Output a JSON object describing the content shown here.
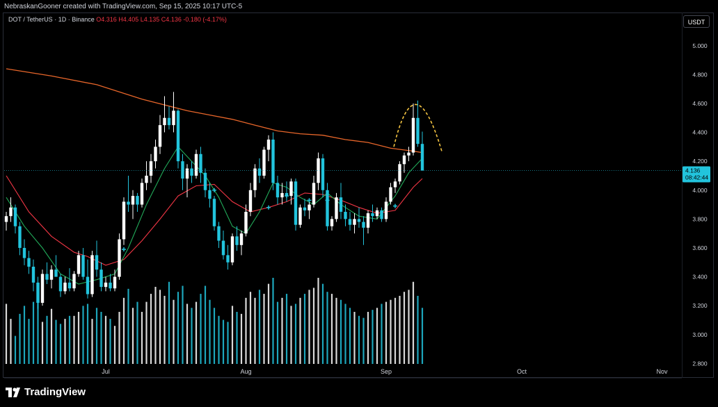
{
  "header": {
    "credit": "NebraskanGooner created with TradingView.com, Sep 15, 2025 10:17 UTC-5"
  },
  "legend": {
    "symbol": "DOT / TetherUS · 1D · Binance",
    "ohlc": "O4.316  H4.405  L4.135  C4.136  -0.180 (-4.17%)"
  },
  "price_axis": {
    "unit": "USDT"
  },
  "last_price": {
    "value": "4.136",
    "countdown": "08:42:44"
  },
  "footer": {
    "brand": "TradingView"
  },
  "colors": {
    "up": "#ffffff",
    "down": "#22c4dd",
    "ma_long": "#e8662a",
    "ma_mid": "#f23645",
    "ma_short": "#22ab5a",
    "annotation": "#f5c542",
    "badge": "#22c4dd"
  },
  "chart_data": {
    "type": "candlestick",
    "interval": "1D",
    "ylim": [
      2.72,
      5.22
    ],
    "y_ticks": [
      2.8,
      3.0,
      3.2,
      3.4,
      3.6,
      3.8,
      4.0,
      4.2,
      4.4,
      4.6,
      4.8,
      5.0
    ],
    "x_ticks": [
      "Jul",
      "Aug",
      "Sep",
      "Oct",
      "Nov"
    ],
    "x_range_days": [
      "2025-06-09",
      "2025-11-18"
    ],
    "ohlc_daily_from": "2025-06-09",
    "candles": [
      [
        3.78,
        3.85,
        3.72,
        3.82
      ],
      [
        3.82,
        3.95,
        3.78,
        3.88
      ],
      [
        3.88,
        3.9,
        3.7,
        3.75
      ],
      [
        3.75,
        3.78,
        3.55,
        3.6
      ],
      [
        3.6,
        3.66,
        3.48,
        3.53
      ],
      [
        3.53,
        3.58,
        3.42,
        3.47
      ],
      [
        3.47,
        3.52,
        3.3,
        3.36
      ],
      [
        3.36,
        3.4,
        3.18,
        3.22
      ],
      [
        3.22,
        3.45,
        3.2,
        3.42
      ],
      [
        3.42,
        3.5,
        3.35,
        3.38
      ],
      [
        3.38,
        3.48,
        3.32,
        3.45
      ],
      [
        3.45,
        3.55,
        3.4,
        3.4
      ],
      [
        3.4,
        3.42,
        3.26,
        3.3
      ],
      [
        3.3,
        3.4,
        3.28,
        3.36
      ],
      [
        3.36,
        3.46,
        3.3,
        3.32
      ],
      [
        3.32,
        3.44,
        3.3,
        3.42
      ],
      [
        3.42,
        3.58,
        3.4,
        3.55
      ],
      [
        3.55,
        3.6,
        3.38,
        3.4
      ],
      [
        3.4,
        3.52,
        3.25,
        3.28
      ],
      [
        3.28,
        3.58,
        3.26,
        3.55
      ],
      [
        3.55,
        3.65,
        3.4,
        3.45
      ],
      [
        3.45,
        3.5,
        3.3,
        3.33
      ],
      [
        3.33,
        3.4,
        3.3,
        3.36
      ],
      [
        3.36,
        3.42,
        3.3,
        3.32
      ],
      [
        3.32,
        3.45,
        3.3,
        3.4
      ],
      [
        3.4,
        3.7,
        3.38,
        3.66
      ],
      [
        3.66,
        3.95,
        3.62,
        3.92
      ],
      [
        3.92,
        4.1,
        3.85,
        3.9
      ],
      [
        3.9,
        4.0,
        3.8,
        3.96
      ],
      [
        3.96,
        3.98,
        3.85,
        3.9
      ],
      [
        3.9,
        4.08,
        3.88,
        4.05
      ],
      [
        4.05,
        4.2,
        4.0,
        4.1
      ],
      [
        4.1,
        4.25,
        4.05,
        4.2
      ],
      [
        4.2,
        4.35,
        4.15,
        4.3
      ],
      [
        4.3,
        4.52,
        4.25,
        4.45
      ],
      [
        4.45,
        4.65,
        4.4,
        4.5
      ],
      [
        4.5,
        4.58,
        4.42,
        4.45
      ],
      [
        4.45,
        4.68,
        4.4,
        4.55
      ],
      [
        4.55,
        4.56,
        4.15,
        4.2
      ],
      [
        4.2,
        4.25,
        4.0,
        4.08
      ],
      [
        4.08,
        4.18,
        3.95,
        4.15
      ],
      [
        4.15,
        4.2,
        4.05,
        4.1
      ],
      [
        4.1,
        4.28,
        4.08,
        4.25
      ],
      [
        4.25,
        4.3,
        4.05,
        4.12
      ],
      [
        4.12,
        4.15,
        3.95,
        4.0
      ],
      [
        4.0,
        4.05,
        3.88,
        3.94
      ],
      [
        3.94,
        3.96,
        3.72,
        3.75
      ],
      [
        3.75,
        3.78,
        3.6,
        3.65
      ],
      [
        3.65,
        3.72,
        3.52,
        3.55
      ],
      [
        3.55,
        3.62,
        3.45,
        3.5
      ],
      [
        3.5,
        3.7,
        3.48,
        3.68
      ],
      [
        3.68,
        3.75,
        3.58,
        3.62
      ],
      [
        3.62,
        3.72,
        3.55,
        3.7
      ],
      [
        3.7,
        3.9,
        3.68,
        3.85
      ],
      [
        3.85,
        4.05,
        3.82,
        4.0
      ],
      [
        4.0,
        4.18,
        3.95,
        4.15
      ],
      [
        4.15,
        4.22,
        4.05,
        4.1
      ],
      [
        4.1,
        4.3,
        4.08,
        4.28
      ],
      [
        4.28,
        4.38,
        4.2,
        4.35
      ],
      [
        4.35,
        4.4,
        4.0,
        4.05
      ],
      [
        4.05,
        4.1,
        3.9,
        3.95
      ],
      [
        3.95,
        4.05,
        3.9,
        3.98
      ],
      [
        3.98,
        4.06,
        3.92,
        3.96
      ],
      [
        3.96,
        4.08,
        3.9,
        4.06
      ],
      [
        4.06,
        4.08,
        3.72,
        3.76
      ],
      [
        3.76,
        3.9,
        3.74,
        3.88
      ],
      [
        3.88,
        3.94,
        3.82,
        3.86
      ],
      [
        3.86,
        3.92,
        3.8,
        3.9
      ],
      [
        3.9,
        4.1,
        3.88,
        4.05
      ],
      [
        4.05,
        4.26,
        4.0,
        4.22
      ],
      [
        4.22,
        4.25,
        3.95,
        4.0
      ],
      [
        4.0,
        4.05,
        3.72,
        3.75
      ],
      [
        3.75,
        3.82,
        3.72,
        3.8
      ],
      [
        3.8,
        3.98,
        3.78,
        3.95
      ],
      [
        3.95,
        4.05,
        3.8,
        3.85
      ],
      [
        3.85,
        3.9,
        3.75,
        3.8
      ],
      [
        3.8,
        3.85,
        3.72,
        3.76
      ],
      [
        3.76,
        3.84,
        3.7,
        3.8
      ],
      [
        3.8,
        3.88,
        3.74,
        3.78
      ],
      [
        3.78,
        3.82,
        3.62,
        3.74
      ],
      [
        3.74,
        3.86,
        3.7,
        3.84
      ],
      [
        3.84,
        3.9,
        3.78,
        3.82
      ],
      [
        3.82,
        3.88,
        3.8,
        3.86
      ],
      [
        3.86,
        3.88,
        3.78,
        3.8
      ],
      [
        3.8,
        3.95,
        3.78,
        3.92
      ],
      [
        3.92,
        4.05,
        3.9,
        4.02
      ],
      [
        4.02,
        4.08,
        3.98,
        4.06
      ],
      [
        4.06,
        4.2,
        4.04,
        4.18
      ],
      [
        4.18,
        4.26,
        4.12,
        4.24
      ],
      [
        4.24,
        4.3,
        4.2,
        4.26
      ],
      [
        4.26,
        4.6,
        4.24,
        4.5
      ],
      [
        4.5,
        4.62,
        4.3,
        4.32
      ],
      [
        4.32,
        4.405,
        4.135,
        4.136
      ]
    ],
    "moving_averages": [
      {
        "name": "long",
        "color": "#e8662a",
        "values": [
          [
            0,
            4.84
          ],
          [
            10,
            4.79
          ],
          [
            20,
            4.73
          ],
          [
            30,
            4.63
          ],
          [
            40,
            4.55
          ],
          [
            45,
            4.52
          ],
          [
            50,
            4.49
          ],
          [
            55,
            4.45
          ],
          [
            60,
            4.41
          ],
          [
            65,
            4.39
          ],
          [
            70,
            4.38
          ],
          [
            75,
            4.35
          ],
          [
            80,
            4.33
          ],
          [
            85,
            4.29
          ],
          [
            90,
            4.27
          ],
          [
            92,
            4.26
          ]
        ]
      },
      {
        "name": "mid",
        "color": "#f23645",
        "values": [
          [
            0,
            4.1
          ],
          [
            5,
            3.85
          ],
          [
            10,
            3.68
          ],
          [
            15,
            3.57
          ],
          [
            18,
            3.54
          ],
          [
            22,
            3.48
          ],
          [
            26,
            3.52
          ],
          [
            30,
            3.65
          ],
          [
            34,
            3.8
          ],
          [
            38,
            3.96
          ],
          [
            42,
            4.03
          ],
          [
            46,
            4.04
          ],
          [
            50,
            3.92
          ],
          [
            54,
            3.85
          ],
          [
            58,
            3.88
          ],
          [
            62,
            3.92
          ],
          [
            66,
            3.98
          ],
          [
            70,
            3.97
          ],
          [
            74,
            3.93
          ],
          [
            78,
            3.88
          ],
          [
            82,
            3.84
          ],
          [
            86,
            3.86
          ],
          [
            90,
            4.02
          ],
          [
            92,
            4.08
          ]
        ]
      },
      {
        "name": "short",
        "color": "#22ab5a",
        "values": [
          [
            0,
            3.95
          ],
          [
            4,
            3.75
          ],
          [
            8,
            3.6
          ],
          [
            12,
            3.42
          ],
          [
            16,
            3.35
          ],
          [
            20,
            3.38
          ],
          [
            24,
            3.42
          ],
          [
            27,
            3.6
          ],
          [
            31,
            3.9
          ],
          [
            35,
            4.15
          ],
          [
            38,
            4.3
          ],
          [
            41,
            4.2
          ],
          [
            44,
            4.1
          ],
          [
            47,
            3.95
          ],
          [
            50,
            3.75
          ],
          [
            53,
            3.7
          ],
          [
            56,
            3.85
          ],
          [
            59,
            4.05
          ],
          [
            62,
            4.02
          ],
          [
            65,
            3.95
          ],
          [
            68,
            3.9
          ],
          [
            71,
            3.98
          ],
          [
            74,
            3.9
          ],
          [
            78,
            3.82
          ],
          [
            82,
            3.8
          ],
          [
            86,
            3.96
          ],
          [
            89,
            4.12
          ],
          [
            92,
            4.22
          ]
        ]
      }
    ],
    "volume": [
      60,
      45,
      28,
      50,
      58,
      45,
      62,
      72,
      42,
      48,
      55,
      44,
      40,
      45,
      48,
      48,
      52,
      58,
      60,
      45,
      56,
      52,
      48,
      45,
      38,
      52,
      66,
      75,
      56,
      62,
      52,
      62,
      70,
      77,
      74,
      68,
      82,
      64,
      72,
      78,
      60,
      56,
      62,
      70,
      78,
      64,
      56,
      48,
      44,
      42,
      58,
      52,
      50,
      66,
      72,
      66,
      74,
      70,
      80,
      86,
      62,
      66,
      70,
      58,
      60,
      66,
      70,
      74,
      76,
      86,
      80,
      72,
      70,
      66,
      64,
      60,
      56,
      52,
      48,
      46,
      52,
      54,
      56,
      60,
      62,
      64,
      66,
      68,
      72,
      74,
      82,
      68,
      56
    ],
    "volume_markers": [
      6,
      49
    ]
  }
}
